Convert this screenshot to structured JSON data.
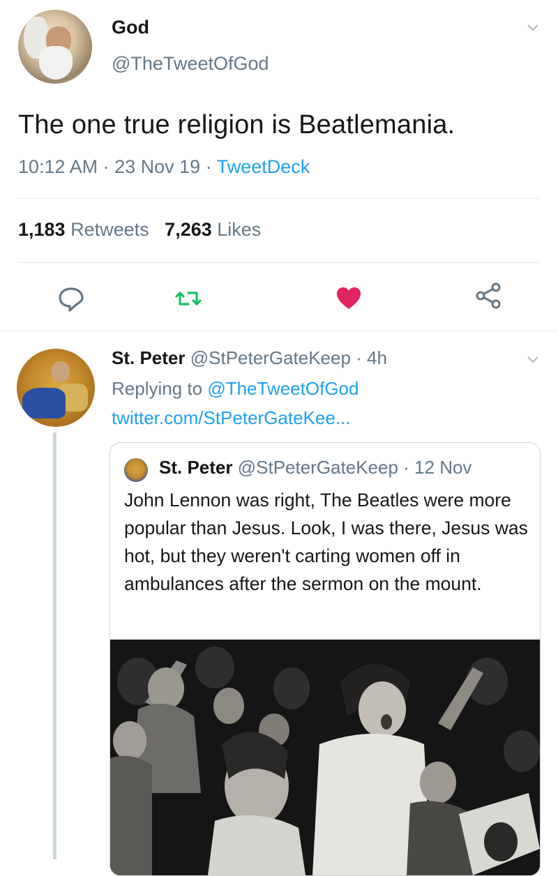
{
  "tweet": {
    "author_name": "God",
    "author_handle": "@TheTweetOfGod",
    "text": "The one true religion is Beatlemania.",
    "time": "10:12 AM",
    "date": "23 Nov 19",
    "source": "TweetDeck",
    "retweets_count": "1,183",
    "retweets_label": "Retweets",
    "likes_count": "7,263",
    "likes_label": "Likes"
  },
  "reply": {
    "author_name": "St. Peter",
    "author_handle": "@StPeterGateKeep",
    "age": "4h",
    "replying_label": "Replying to",
    "replying_to": "@TheTweetOfGod",
    "link": "twitter.com/StPeterGateKee...",
    "quote": {
      "author_name": "St. Peter",
      "author_handle": "@StPeterGateKeep",
      "date": "12 Nov",
      "text": "John Lennon was right, The Beatles were more popular than Jesus. Look, I was there, Jesus was hot, but they weren't carting women off in ambulances after the sermon on the mount."
    }
  },
  "icons": {
    "reply": "speech-bubble-icon",
    "retweet": "retweet-icon",
    "like": "heart-icon",
    "share": "share-icon",
    "menu": "chevron-down-icon"
  },
  "colors": {
    "accent": "#1da1f2",
    "retweet_green": "#17bf63",
    "like_red": "#e0245e",
    "muted": "#657786"
  }
}
